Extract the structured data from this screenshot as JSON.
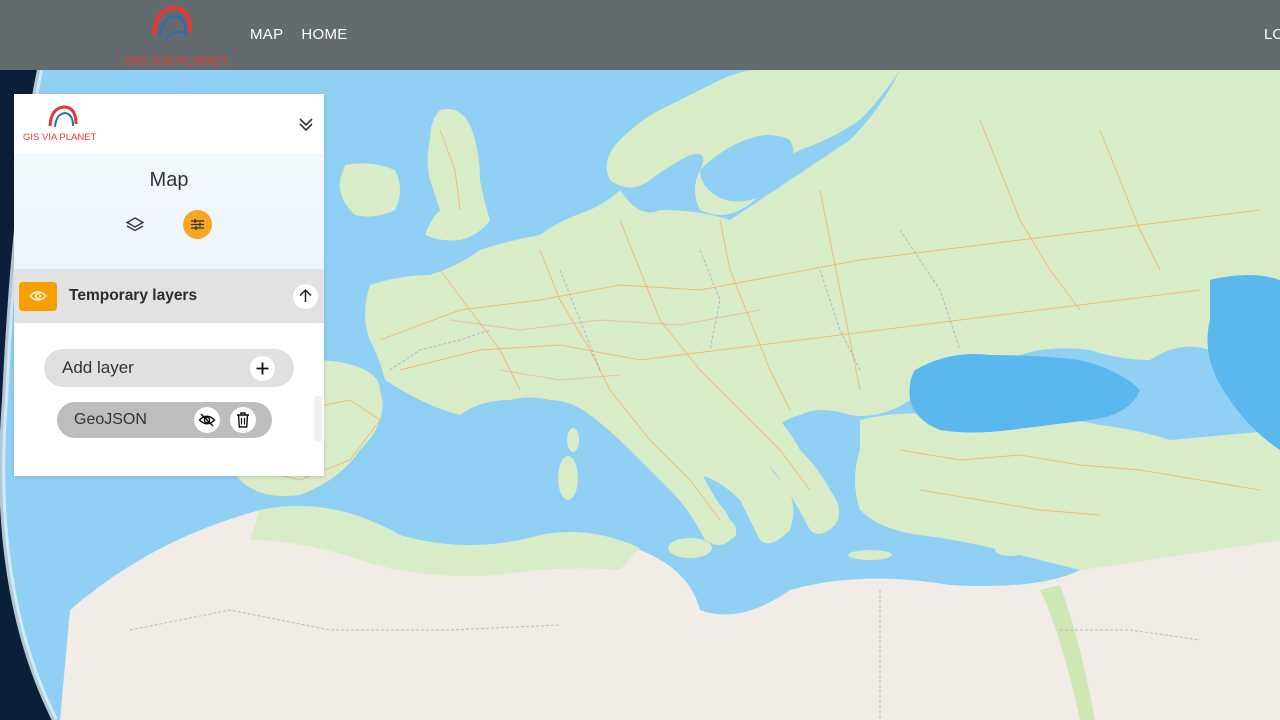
{
  "header": {
    "brand_text": "GIS VIA PLANET",
    "nav": [
      {
        "label": "MAP"
      },
      {
        "label": "HOME"
      }
    ],
    "login_label": "LO"
  },
  "panel": {
    "logo_text": "GIS VIA PLANET",
    "title": "Map",
    "section": {
      "title": "Temporary layers"
    },
    "add_layer_label": "Add layer",
    "layers": [
      {
        "name": "GeoJSON"
      }
    ]
  },
  "icons": {
    "collapse": "double-chevron-down-icon",
    "layers": "layers-icon",
    "settings": "sliders-icon",
    "visibility": "eye-icon",
    "collapse_section": "arrow-up-icon",
    "add": "plus-icon",
    "hide": "eye-off-icon",
    "delete": "trash-icon"
  },
  "colors": {
    "topbar": "#636b6e",
    "brand_red": "#e53935",
    "accent_orange": "#f5a623",
    "sea": "#8fd0f4",
    "land": "#d9ecc8",
    "desert": "#f1ede6"
  }
}
